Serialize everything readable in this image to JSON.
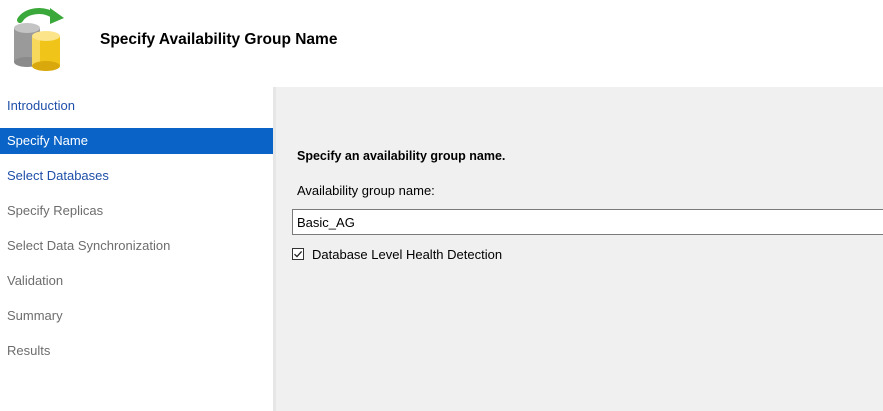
{
  "header": {
    "title": "Specify Availability Group Name",
    "icon": "database-refresh-icon"
  },
  "sidebar": {
    "items": [
      {
        "label": "Introduction",
        "state": "link"
      },
      {
        "label": "Specify Name",
        "state": "selected"
      },
      {
        "label": "Select Databases",
        "state": "link"
      },
      {
        "label": "Specify Replicas",
        "state": "disabled"
      },
      {
        "label": "Select Data Synchronization",
        "state": "disabled"
      },
      {
        "label": "Validation",
        "state": "disabled"
      },
      {
        "label": "Summary",
        "state": "disabled"
      },
      {
        "label": "Results",
        "state": "disabled"
      }
    ]
  },
  "main": {
    "heading": "Specify an availability group name.",
    "name_label": "Availability group name:",
    "name_value": "Basic_AG",
    "health_detection": {
      "label": "Database Level Health Detection",
      "checked": true
    }
  },
  "colors": {
    "selected_bg": "#0a64c8",
    "link": "#1f4fa8",
    "disabled": "#6d6d6d",
    "content_bg": "#f0f0f0"
  }
}
